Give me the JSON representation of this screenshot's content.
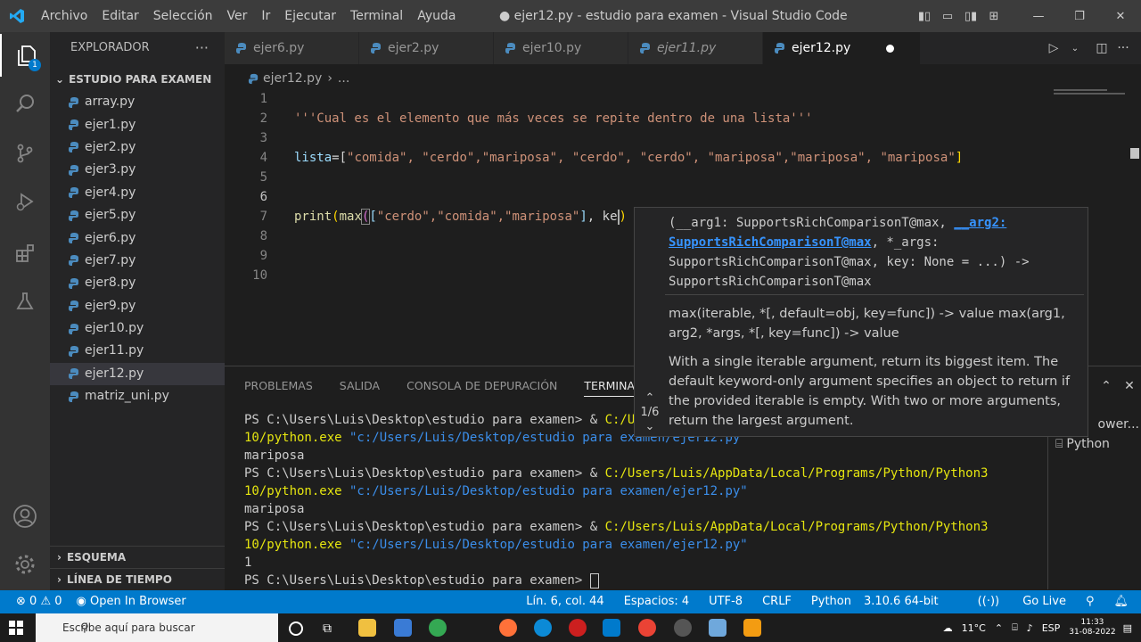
{
  "titlebar": {
    "menu": [
      "Archivo",
      "Editar",
      "Selección",
      "Ver",
      "Ir",
      "Ejecutar",
      "Terminal",
      "Ayuda"
    ],
    "window_title": "● ejer12.py - estudio para examen - Visual Studio Code"
  },
  "activity": {
    "explorer_badge": "1"
  },
  "sidebar": {
    "header": "EXPLORADOR",
    "folder": "ESTUDIO PARA EXAMEN",
    "files": [
      "array.py",
      "ejer1.py",
      "ejer2.py",
      "ejer3.py",
      "ejer4.py",
      "ejer5.py",
      "ejer6.py",
      "ejer7.py",
      "ejer8.py",
      "ejer9.py",
      "ejer10.py",
      "ejer11.py",
      "ejer12.py",
      "matriz_uni.py"
    ],
    "selected_file": "ejer12.py",
    "outline": "ESQUEMA",
    "timeline": "LÍNEA DE TIEMPO"
  },
  "tabs": [
    "ejer6.py",
    "ejer2.py",
    "ejer10.py",
    "ejer11.py",
    "ejer12.py"
  ],
  "breadcrumb": {
    "file": "ejer12.py",
    "rest": "..."
  },
  "editor": {
    "line_numbers": [
      "1",
      "2",
      "3",
      "4",
      "5",
      "6",
      "7",
      "8",
      "9",
      "10"
    ],
    "current_line": "6",
    "line1": "'''Cual es el elemento que más veces se repite dentro de una lista'''",
    "line3": {
      "var": "lista",
      "eq": "=[",
      "items": "\"comida\", \"cerdo\",\"mariposa\", \"cerdo\", \"cerdo\", \"mariposa\",\"mariposa\", \"mariposa\"",
      "close": "]"
    },
    "line6": {
      "fn1": "print",
      "fn2": "max",
      "list": "\"cerdo\",\"comida\",\"mariposa\"",
      "tail": ", ke",
      "close": ")"
    }
  },
  "hover": {
    "sig_a": "(__arg1: SupportsRichComparisonT@max, ",
    "sig_hl": "__arg2: SupportsRichComparisonT@max",
    "sig_b": ", *_args: SupportsRichComparisonT@max, key: None = ...) -> SupportsRichComparisonT@max",
    "doc1": "max(iterable, *[, default=obj, key=func]) -> value max(arg1, arg2, *args, *[, key=func]) -> value",
    "doc2": "With a single iterable argument, return its biggest item. The default keyword-only argument specifies an object to return if the provided iterable is empty. With two or more arguments, return the largest argument.",
    "counter": "1/6"
  },
  "panel": {
    "tabs": [
      "PROBLEMAS",
      "SALIDA",
      "CONSOLA DE DEPURACIÓN",
      "TERMINAL"
    ],
    "active_tab": "TERMINAL",
    "terminal_list": [
      "Open In Browser",
      "Python"
    ],
    "terminal": [
      {
        "prompt": "PS C:\\Users\\Luis\\Desktop\\estudio para examen> & ",
        "exe": "C:/Users/Luis/AppData/Local/Programs/Python/Python3",
        "exe2": "10/python.exe",
        "arg": " \"c:/Users/Luis/Desktop/estudio para examen/ejer12.py\"",
        "out": "mariposa"
      },
      {
        "prompt": "PS C:\\Users\\Luis\\Desktop\\estudio para examen> & ",
        "exe": "C:/Users/Luis/AppData/Local/Programs/Python/Python3",
        "exe2": "10/python.exe",
        "arg": " \"c:/Users/Luis/Desktop/estudio para examen/ejer12.py\"",
        "out": "mariposa"
      },
      {
        "prompt": "PS C:\\Users\\Luis\\Desktop\\estudio para examen> & ",
        "exe": "C:/Users/Luis/AppData/Local/Programs/Python/Python3",
        "exe2": "10/python.exe",
        "arg": " \"c:/Users/Luis/Desktop/estudio para examen/ejer12.py\"",
        "out": "1"
      }
    ],
    "last_prompt": "PS C:\\Users\\Luis\\Desktop\\estudio para examen> "
  },
  "status": {
    "errors": "0",
    "warnings": "0",
    "open_browser": "Open In Browser",
    "position": "Lín. 6, col. 44",
    "spaces": "Espacios: 4",
    "encoding": "UTF-8",
    "eol": "CRLF",
    "language": "Python",
    "interpreter": "3.10.6 64-bit",
    "golive": "Go Live"
  },
  "taskbar": {
    "search_placeholder": "Escribe aquí para buscar",
    "temp": "11°C",
    "lang": "ESP",
    "time": "11:33",
    "date": "31-08-2022"
  },
  "colors": {
    "accent": "#007acc",
    "string": "#ce9178",
    "variable": "#9cdcfe",
    "function": "#dcdcaa",
    "link": "#3794ff"
  }
}
